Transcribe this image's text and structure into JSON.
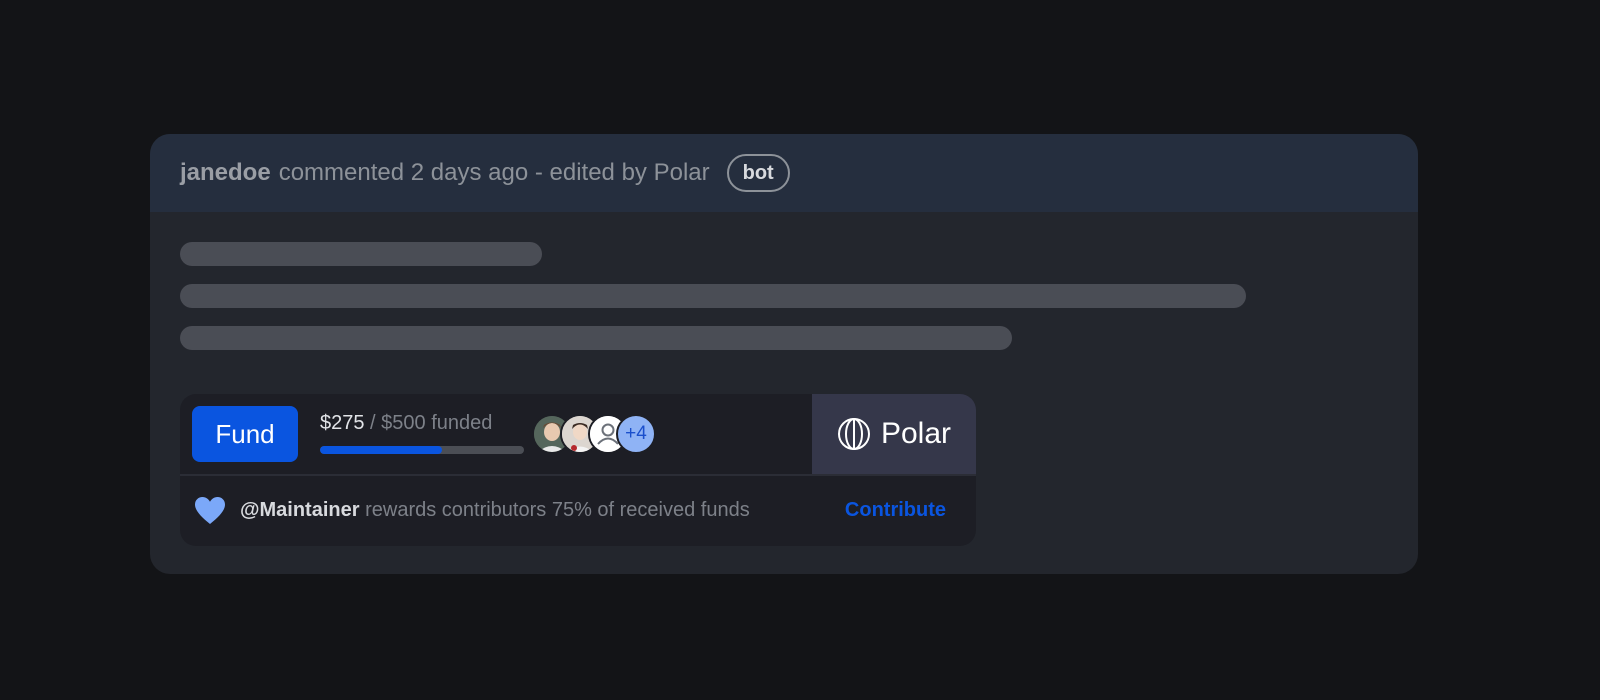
{
  "comment": {
    "author": "janedoe",
    "meta": "commented 2 days ago - edited by Polar",
    "badge": "bot"
  },
  "funding": {
    "fund_label": "Fund",
    "amount": "$275",
    "goal_text": " / $500 funded",
    "progress": 0.6,
    "extra_backers": "+4",
    "brand_name": "Polar",
    "maintainer": "@Maintainer",
    "reward_text": " rewards contributors 75% of received funds",
    "contribute_label": "Contribute"
  },
  "colors": {
    "accent": "#0a55e0",
    "heart": "#7ba8f9",
    "card_bg": "#23262d",
    "header_bg": "#252e3e"
  }
}
